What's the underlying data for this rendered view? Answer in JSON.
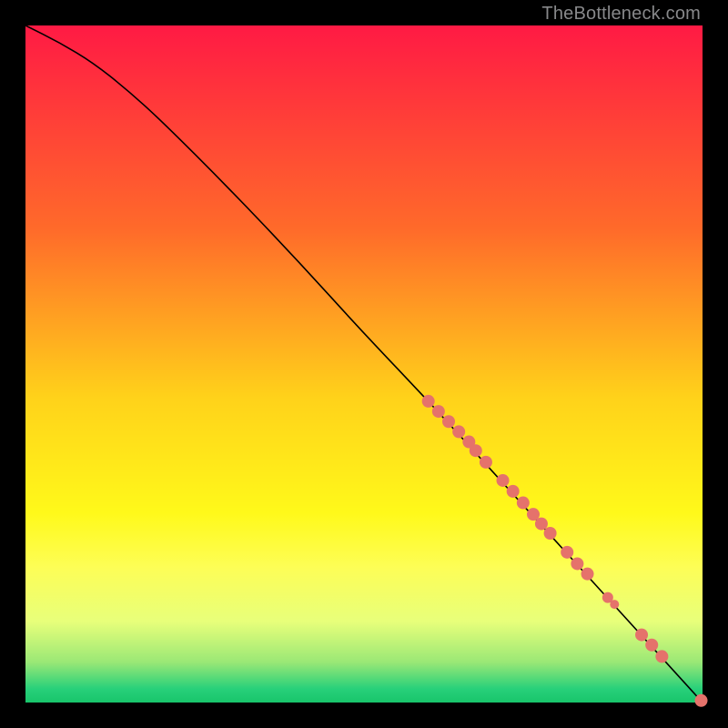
{
  "watermark": "TheBottleneck.com",
  "chart_data": {
    "type": "line",
    "title": "",
    "xlabel": "",
    "ylabel": "",
    "xlim": [
      0,
      1
    ],
    "ylim": [
      0,
      1
    ],
    "grid": false,
    "legend": false,
    "axes_visible": false,
    "background_gradient": {
      "direction": "top-to-bottom",
      "stops": [
        {
          "pos": 0.0,
          "color": "#ff1a44"
        },
        {
          "pos": 0.3,
          "color": "#ff6a2a"
        },
        {
          "pos": 0.55,
          "color": "#ffd21a"
        },
        {
          "pos": 0.72,
          "color": "#fff91a"
        },
        {
          "pos": 0.8,
          "color": "#fdfe56"
        },
        {
          "pos": 0.88,
          "color": "#e8ff7a"
        },
        {
          "pos": 0.94,
          "color": "#9be876"
        },
        {
          "pos": 0.98,
          "color": "#27d07a"
        },
        {
          "pos": 1.0,
          "color": "#19c56b"
        }
      ]
    },
    "series": [
      {
        "name": "curve",
        "color": "#000000",
        "linewidth": 1.6,
        "x": [
          0.0,
          0.05,
          0.1,
          0.15,
          0.2,
          0.3,
          0.4,
          0.5,
          0.6,
          0.7,
          0.8,
          0.9,
          1.0
        ],
        "y": [
          1.0,
          0.975,
          0.945,
          0.905,
          0.86,
          0.76,
          0.655,
          0.545,
          0.44,
          0.33,
          0.22,
          0.11,
          0.0
        ]
      }
    ],
    "markers": {
      "color": "#e5726b",
      "radius_default": 7,
      "points": [
        {
          "x": 0.595,
          "y": 0.445,
          "r": 7
        },
        {
          "x": 0.61,
          "y": 0.43,
          "r": 7
        },
        {
          "x": 0.625,
          "y": 0.415,
          "r": 7
        },
        {
          "x": 0.64,
          "y": 0.4,
          "r": 7
        },
        {
          "x": 0.655,
          "y": 0.385,
          "r": 7
        },
        {
          "x": 0.665,
          "y": 0.372,
          "r": 7
        },
        {
          "x": 0.68,
          "y": 0.355,
          "r": 7
        },
        {
          "x": 0.705,
          "y": 0.328,
          "r": 7
        },
        {
          "x": 0.72,
          "y": 0.312,
          "r": 7
        },
        {
          "x": 0.735,
          "y": 0.295,
          "r": 7
        },
        {
          "x": 0.75,
          "y": 0.278,
          "r": 7
        },
        {
          "x": 0.762,
          "y": 0.264,
          "r": 7
        },
        {
          "x": 0.775,
          "y": 0.25,
          "r": 7
        },
        {
          "x": 0.8,
          "y": 0.222,
          "r": 7
        },
        {
          "x": 0.815,
          "y": 0.205,
          "r": 7
        },
        {
          "x": 0.83,
          "y": 0.19,
          "r": 7
        },
        {
          "x": 0.86,
          "y": 0.155,
          "r": 6
        },
        {
          "x": 0.87,
          "y": 0.145,
          "r": 5
        },
        {
          "x": 0.91,
          "y": 0.1,
          "r": 7
        },
        {
          "x": 0.925,
          "y": 0.085,
          "r": 7
        },
        {
          "x": 0.94,
          "y": 0.068,
          "r": 7
        },
        {
          "x": 0.998,
          "y": 0.003,
          "r": 7
        }
      ]
    }
  }
}
